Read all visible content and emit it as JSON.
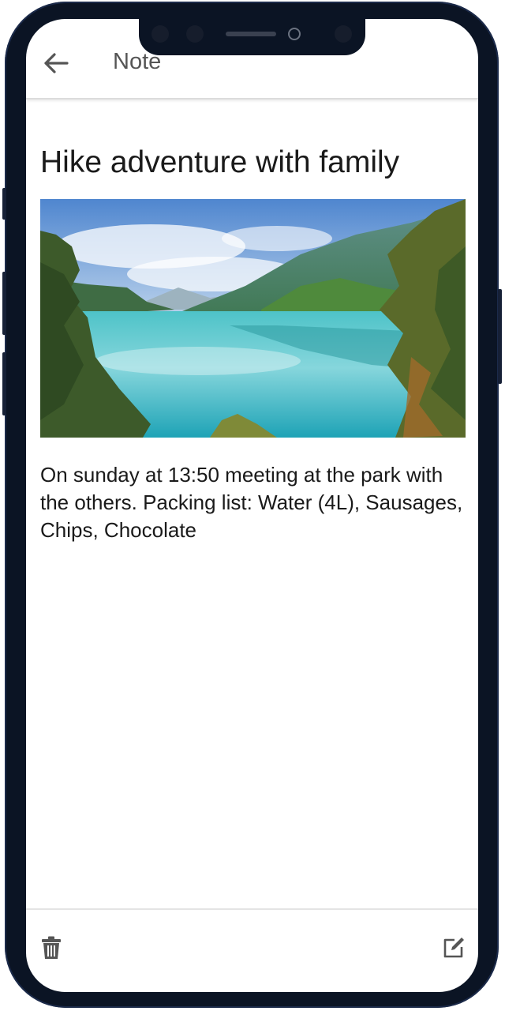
{
  "header": {
    "title": "Note",
    "back_icon": "arrow-left-icon"
  },
  "note": {
    "title": "Hike adventure with family",
    "image_alt": "Lake surrounded by mountains and trees",
    "body": "On sunday at 13:50 meeting at the park with the others. Packing list: Water (4L), Sausages, Chips, Chocolate"
  },
  "bottom_bar": {
    "delete_icon": "trash-icon",
    "edit_icon": "edit-icon"
  },
  "colors": {
    "frame": "#0b1424",
    "text": "#1a1a1a",
    "header_text": "#555555",
    "icon": "#555555"
  }
}
